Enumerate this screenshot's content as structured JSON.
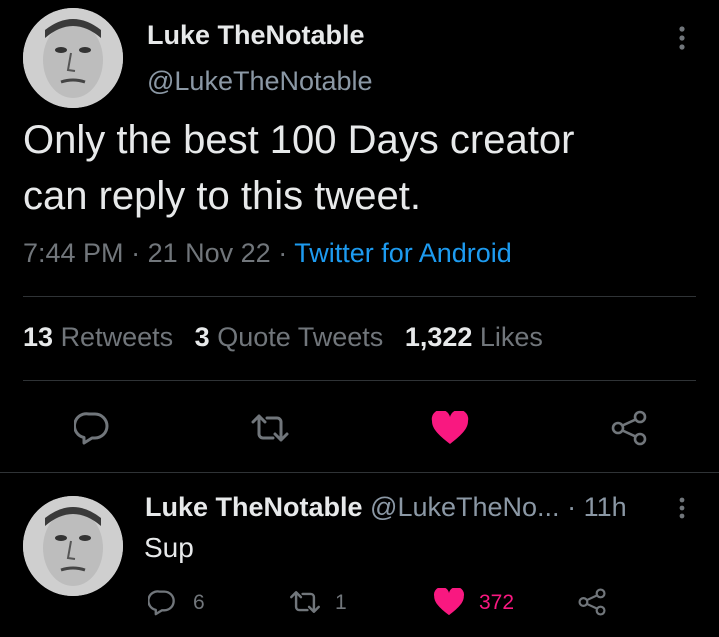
{
  "main_tweet": {
    "author_name": "Luke TheNotable",
    "author_handle": "@LukeTheNotable",
    "text_line1": "Only the best 100 Days creator",
    "text_line2": "can reply to this tweet.",
    "time": "7:44 PM",
    "sep1": "·",
    "date": "21 Nov 22",
    "sep2": "·",
    "source": "Twitter for Android",
    "stats": {
      "retweets_count": "13",
      "retweets_label": "Retweets",
      "quotes_count": "3",
      "quotes_label": "Quote Tweets",
      "likes_count": "1,322",
      "likes_label": "Likes"
    },
    "liked": true
  },
  "reply": {
    "author_name": "Luke TheNotable",
    "author_handle": "@LukeTheNo...",
    "sep": "·",
    "age": "11h",
    "text": "Sup",
    "reply_count": "6",
    "retweet_count": "1",
    "like_count": "372",
    "liked": true
  },
  "icons": {
    "more": "more-vertical-icon",
    "reply": "reply-icon",
    "retweet": "retweet-icon",
    "like": "heart-icon",
    "share": "share-icon"
  },
  "colors": {
    "background": "#000000",
    "text": "#e7e9ea",
    "muted": "#71767b",
    "link": "#1d9bf0",
    "like": "#f91880",
    "divider": "#2f3336"
  }
}
